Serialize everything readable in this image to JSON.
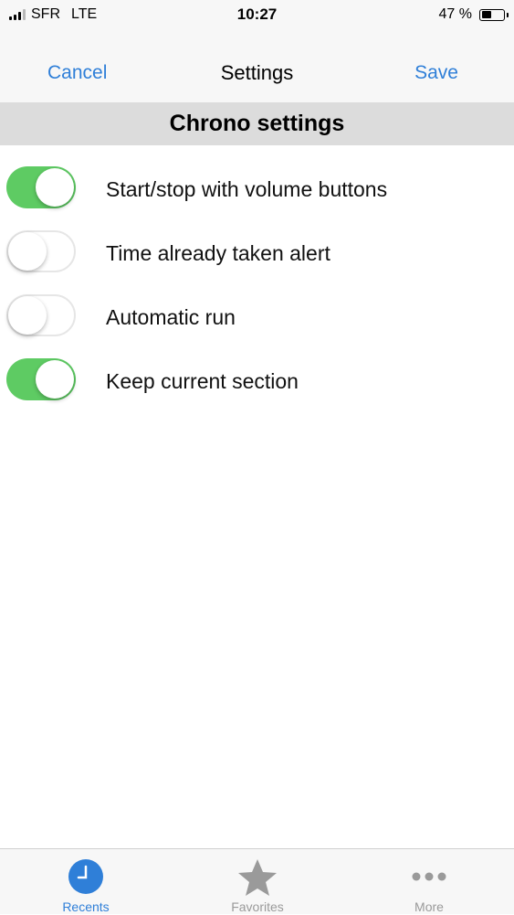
{
  "status_bar": {
    "carrier": "SFR",
    "network": "LTE",
    "time": "10:27",
    "battery_text": "47 %",
    "battery_level": 0.47
  },
  "nav": {
    "cancel_label": "Cancel",
    "title": "Settings",
    "save_label": "Save"
  },
  "section": {
    "title": "Chrono settings"
  },
  "settings": [
    {
      "label": "Start/stop with volume buttons",
      "on": true
    },
    {
      "label": "Time already taken alert",
      "on": false
    },
    {
      "label": "Automatic run",
      "on": false
    },
    {
      "label": "Keep current section",
      "on": true
    }
  ],
  "tabs": [
    {
      "label": "Recents",
      "icon": "clock-icon",
      "active": true
    },
    {
      "label": "Favorites",
      "icon": "star-icon",
      "active": false
    },
    {
      "label": "More",
      "icon": "more-dots-icon",
      "active": false
    }
  ],
  "colors": {
    "accent": "#2f7fd8",
    "toggle_on": "#5ecb63",
    "tab_inactive": "#9a9a9a"
  }
}
